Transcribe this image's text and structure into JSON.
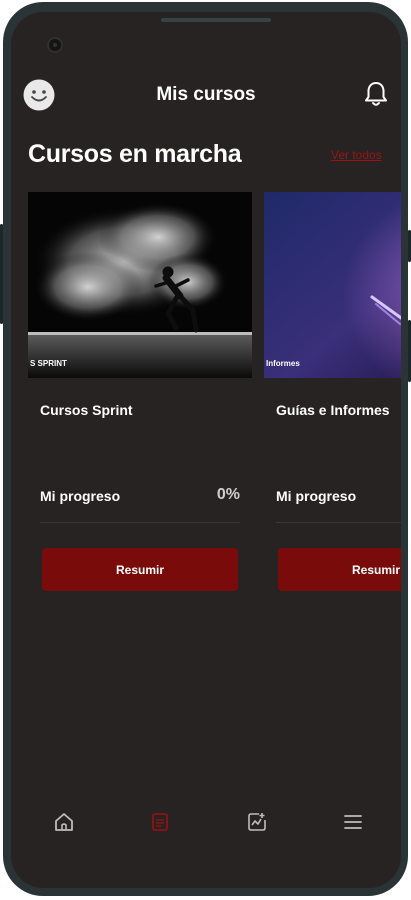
{
  "header": {
    "title": "Mis cursos",
    "avatar_icon": "smiley-avatar",
    "notification_icon": "bell-icon"
  },
  "section": {
    "title": "Cursos en marcha",
    "see_all": "Ver todos"
  },
  "courses": [
    {
      "image_caption": "S SPRINT",
      "title": "Cursos Sprint",
      "progress_label": "Mi progreso",
      "progress_value": "0%",
      "button_label": "Resumir"
    },
    {
      "image_caption": "Informes",
      "title": "Guías e Informes",
      "progress_label": "Mi progreso",
      "progress_value": "",
      "button_label": "Resumir"
    }
  ],
  "bottom_nav": [
    {
      "icon": "home-icon",
      "active": false
    },
    {
      "icon": "courses-icon",
      "active": true
    },
    {
      "icon": "progress-chart-icon",
      "active": false
    },
    {
      "icon": "menu-icon",
      "active": false
    }
  ],
  "colors": {
    "background": "#272323",
    "accent": "#7a0b0b",
    "link": "#9b1414",
    "text": "#ffffff"
  }
}
